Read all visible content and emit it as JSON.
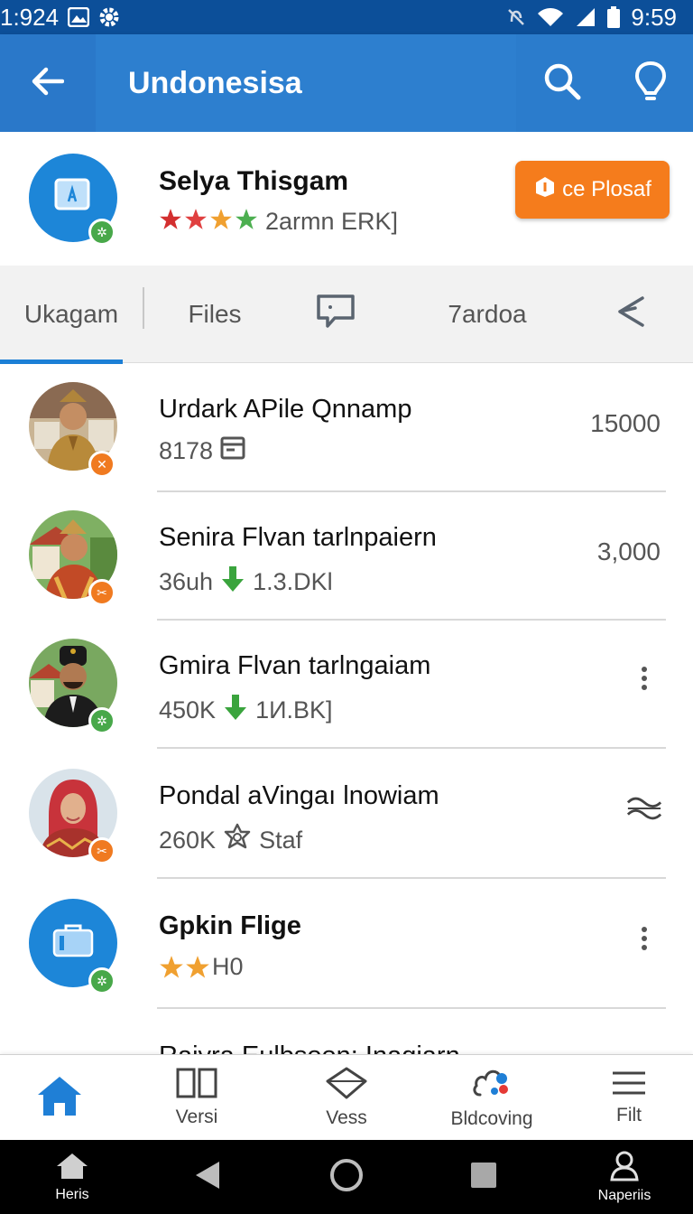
{
  "status_bar": {
    "time_left": "1:924",
    "time_right": "9:59",
    "icons": [
      "image-icon",
      "gear-icon",
      "mute-icon",
      "wifi-icon",
      "signal-icon",
      "battery-icon"
    ]
  },
  "app_bar": {
    "title": "Undonesisa",
    "icons": [
      "back-arrow-icon",
      "search-icon",
      "location-pin-icon"
    ]
  },
  "profile": {
    "name": "Selya Thisgam",
    "rating_text": "2armn ERK]",
    "stars": [
      "red",
      "red-half",
      "orange",
      "green"
    ],
    "button_label": "ce Plosaf"
  },
  "tabs": {
    "items": [
      "Ukagam",
      "Files",
      "chat-icon",
      "7ardoa",
      "share-icon"
    ],
    "active_index": 0
  },
  "list": {
    "rows": [
      {
        "title": "Urdark APile Qnnamp",
        "subtitle": "8178",
        "subtitle_icon": "calendar-icon",
        "trailing": "15000",
        "badge": "orange"
      },
      {
        "title": "Senira Flvan tarlnpaiern",
        "subtitle": "36uh",
        "subtitle_extra": "1.3.DKl",
        "subtitle_icon": "down-arrow-icon",
        "trailing": "3,000",
        "badge": "orange"
      },
      {
        "title": "Gmira Flvan tarlngaiam",
        "subtitle": "450K",
        "subtitle_extra": "1И.BK]",
        "subtitle_icon": "down-arrow-icon",
        "trailing_icon": "more-vert-icon",
        "badge": "green"
      },
      {
        "title": "Pondal aVingaı lnowiam",
        "subtitle": "260K",
        "subtitle_extra": "Staf",
        "subtitle_icon": "badge-star-icon",
        "trailing_icon": "waves-icon",
        "badge": "orange"
      },
      {
        "title": "Gpkin Flige",
        "subtitle": "H0",
        "subtitle_icon": "stars-icon",
        "trailing_icon": "more-vert-icon",
        "badge": "green"
      }
    ],
    "partial_row_title": "Raiyra Eulbsoon: Inagiarn"
  },
  "bottom_nav": {
    "items": [
      {
        "label": "",
        "icon": "home-icon",
        "active": true
      },
      {
        "label": "Versi",
        "icon": "columns-icon"
      },
      {
        "label": "Vess",
        "icon": "diamond-icon"
      },
      {
        "label": "Bldcoving",
        "icon": "cloud-icon"
      },
      {
        "label": "Filt",
        "icon": "menu-icon"
      }
    ]
  },
  "system_nav": {
    "left_label": "Heris",
    "right_label": "Naperiis"
  },
  "colors": {
    "primary": "#2f80d1",
    "status_bar": "#0c4f99",
    "accent_orange": "#f57c1c",
    "badge_green": "#48a84a"
  }
}
